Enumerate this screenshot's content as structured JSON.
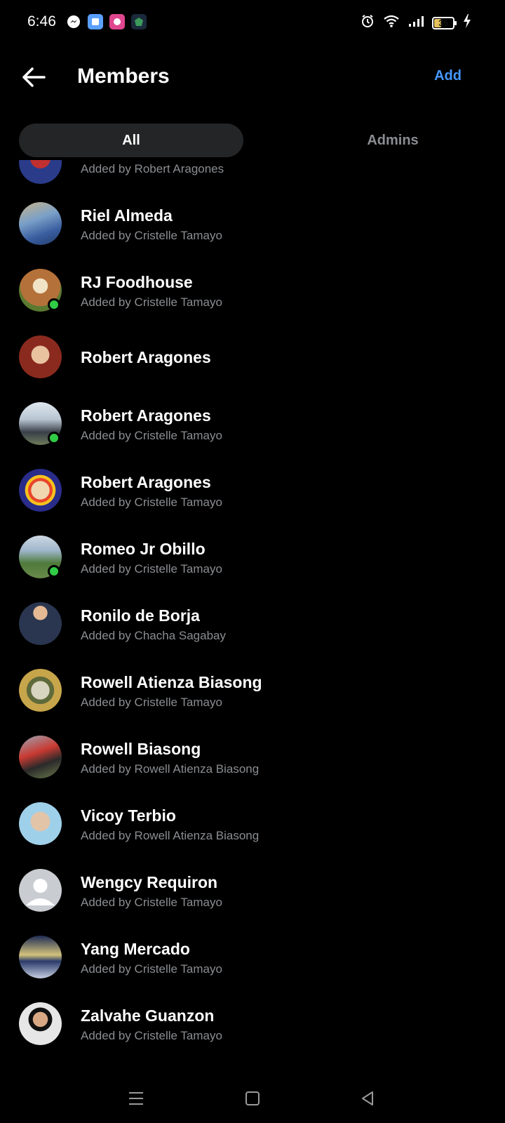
{
  "status_bar": {
    "time": "6:46",
    "battery": "35",
    "icons": [
      "messenger-icon",
      "app-icon",
      "app-icon",
      "app-icon",
      "alarm-icon",
      "wifi-icon",
      "signal-icon",
      "battery-icon",
      "charging-icon"
    ]
  },
  "header": {
    "title": "Members",
    "add_label": "Add"
  },
  "tabs": [
    {
      "label": "All",
      "selected": true
    },
    {
      "label": "Admins",
      "selected": false
    }
  ],
  "members": [
    {
      "name": "",
      "subtitle": "Added by Robert Aragones",
      "online": false
    },
    {
      "name": "Riel Almeda",
      "subtitle": "Added by Cristelle Tamayo",
      "online": false
    },
    {
      "name": "RJ Foodhouse",
      "subtitle": "Added by Cristelle Tamayo",
      "online": true
    },
    {
      "name": "Robert Aragones",
      "subtitle": "",
      "online": false
    },
    {
      "name": "Robert Aragones",
      "subtitle": "Added by Cristelle Tamayo",
      "online": true
    },
    {
      "name": "Robert Aragones",
      "subtitle": "Added by Cristelle Tamayo",
      "online": false
    },
    {
      "name": "Romeo Jr Obillo",
      "subtitle": "Added by Cristelle Tamayo",
      "online": true
    },
    {
      "name": "Ronilo de Borja",
      "subtitle": "Added by Chacha Sagabay",
      "online": false
    },
    {
      "name": "Rowell Atienza Biasong",
      "subtitle": "Added by Cristelle Tamayo",
      "online": false
    },
    {
      "name": "Rowell Biasong",
      "subtitle": "Added by Rowell Atienza Biasong",
      "online": false
    },
    {
      "name": "Vicoy Terbio",
      "subtitle": "Added by Rowell Atienza Biasong",
      "online": false
    },
    {
      "name": "Wengcy Requiron",
      "subtitle": "Added by Cristelle Tamayo",
      "online": false
    },
    {
      "name": "Yang Mercado",
      "subtitle": "Added by Cristelle Tamayo",
      "online": false
    },
    {
      "name": "Zalvahe Guanzon",
      "subtitle": "Added by Cristelle Tamayo",
      "online": false
    }
  ],
  "colors": {
    "background": "#000000",
    "accent": "#4599ff",
    "secondary_text": "#8a8d91",
    "online": "#31cc46",
    "tab_selected_bg": "#242526"
  }
}
